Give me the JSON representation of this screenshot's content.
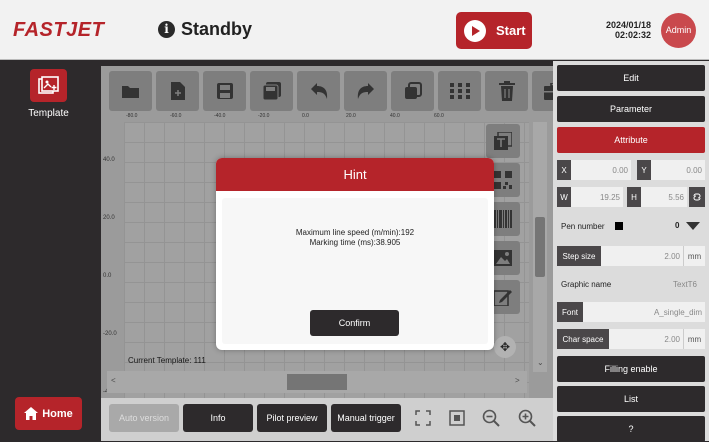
{
  "header": {
    "logo": "FASTJET",
    "status": "Standby",
    "start_label": "Start",
    "date": "2024/01/18",
    "time": "02:02:32",
    "user": "Admin"
  },
  "sidebar": {
    "template_label": "Template",
    "home_label": "Home"
  },
  "canvas": {
    "ruler_top": [
      "-80.0",
      "-60.0",
      "-40.0",
      "-20.0",
      "0.0",
      "20.0",
      "40.0",
      "60.0"
    ],
    "ruler_left": [
      "40.0",
      "20.0",
      "0.0",
      "-20.0",
      "-40.0"
    ],
    "current_template": "Current Template: 111"
  },
  "bottom": {
    "auto_version": "Auto version",
    "info": "Info",
    "pilot_preview": "Pilot preview",
    "manual_trigger": "Manual trigger"
  },
  "panel": {
    "edit": "Edit",
    "parameter": "Parameter",
    "attribute": "Attribute",
    "x_label": "X",
    "x_value": "0.00",
    "y_label": "Y",
    "y_value": "0.00",
    "w_label": "W",
    "w_value": "19.25",
    "h_label": "H",
    "h_value": "5.56",
    "pen_number_label": "Pen number",
    "pen_number_value": "0",
    "step_size_label": "Step size",
    "step_size_value": "2.00",
    "step_size_unit": "mm",
    "graphic_name_label": "Graphic name",
    "graphic_name_value": "TextT6",
    "font_label": "Font",
    "font_value": "A_single_dim",
    "char_space_label": "Char space",
    "char_space_value": "2.00",
    "char_space_unit": "mm",
    "filling_enable": "Filling enable",
    "list": "List",
    "help": "?"
  },
  "dialog": {
    "title": "Hint",
    "line1": "Maximum line speed (m/min):192",
    "line2": "Marking time (ms):38.905",
    "confirm": "Confirm"
  }
}
